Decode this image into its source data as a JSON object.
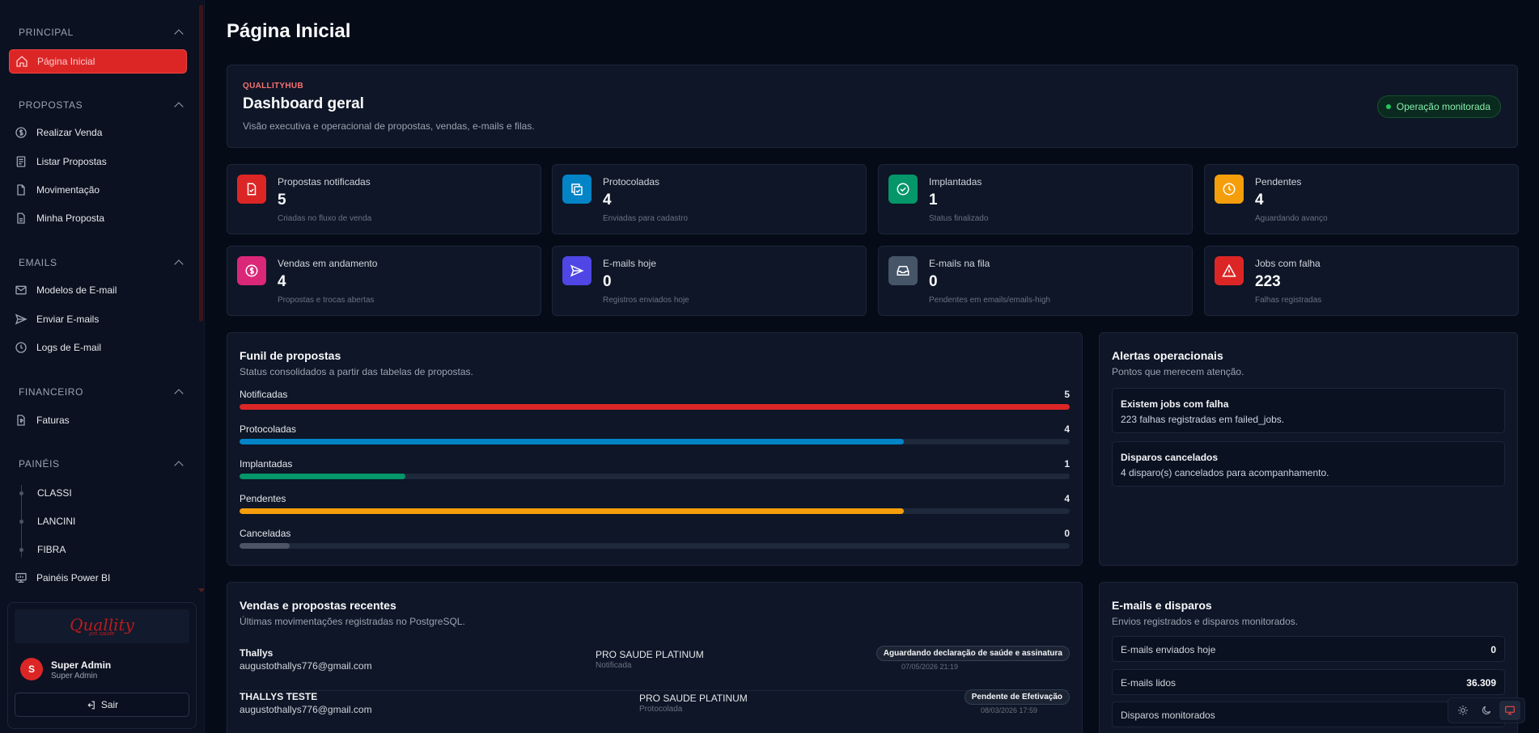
{
  "sidebar": {
    "sections": {
      "principal": "PRINCIPAL",
      "propostas": "PROPOSTAS",
      "emails": "EMAILS",
      "financeiro": "FINANCEIRO",
      "paineis": "PAINÉIS"
    },
    "items": {
      "home": "Página Inicial",
      "realizar_venda": "Realizar Venda",
      "listar_propostas": "Listar Propostas",
      "movimentacao": "Movimentação",
      "minha_proposta": "Minha Proposta",
      "modelos_email": "Modelos de E-mail",
      "enviar_emails": "Enviar E-mails",
      "logs_email": "Logs de E-mail",
      "faturas": "Faturas",
      "classi": "CLASSI",
      "lancini": "LANCINI",
      "fibra": "FIBRA",
      "paineis_powerbi": "Painéis Power BI"
    },
    "logo": {
      "word": "Quallity",
      "sub": "pró saúde"
    },
    "user": {
      "initial": "S",
      "name": "Super Admin",
      "role": "Super Admin"
    },
    "logout_label": "Sair"
  },
  "page": {
    "title": "Página Inicial"
  },
  "hero": {
    "brand": "QUALLITYHUB",
    "title": "Dashboard geral",
    "subtitle": "Visão executiva e operacional de propostas, vendas, e-mails e filas.",
    "badge": "Operação monitorada"
  },
  "stats": [
    {
      "label": "Propostas notificadas",
      "value": "5",
      "hint": "Criadas no fluxo de venda",
      "icon": "file-check-icon",
      "color": "#dc2626"
    },
    {
      "label": "Protocoladas",
      "value": "4",
      "hint": "Enviadas para cadastro",
      "icon": "copy-check-icon",
      "color": "#0284c7"
    },
    {
      "label": "Implantadas",
      "value": "1",
      "hint": "Status finalizado",
      "icon": "check-circle-icon",
      "color": "#059669"
    },
    {
      "label": "Pendentes",
      "value": "4",
      "hint": "Aguardando avanço",
      "icon": "clock-icon",
      "color": "#f59e0b"
    },
    {
      "label": "Vendas em andamento",
      "value": "4",
      "hint": "Propostas e trocas abertas",
      "icon": "dollar-circle-icon",
      "color": "#db2777"
    },
    {
      "label": "E-mails hoje",
      "value": "0",
      "hint": "Registros enviados hoje",
      "icon": "send-icon",
      "color": "#4f46e5"
    },
    {
      "label": "E-mails na fila",
      "value": "0",
      "hint": "Pendentes em emails/emails-high",
      "icon": "inbox-icon",
      "color": "#475569"
    },
    {
      "label": "Jobs com falha",
      "value": "223",
      "hint": "Falhas registradas",
      "icon": "warning-icon",
      "color": "#dc2626"
    }
  ],
  "funnel": {
    "title": "Funil de propostas",
    "subtitle": "Status consolidados a partir das tabelas de propostas.",
    "rows": [
      {
        "label": "Notificadas",
        "value": "5",
        "fraction": 1.0,
        "color": "#dc2626"
      },
      {
        "label": "Protocoladas",
        "value": "4",
        "fraction": 0.8,
        "color": "#0284c7"
      },
      {
        "label": "Implantadas",
        "value": "1",
        "fraction": 0.2,
        "color": "#059669"
      },
      {
        "label": "Pendentes",
        "value": "4",
        "fraction": 0.8,
        "color": "#f59e0b"
      },
      {
        "label": "Canceladas",
        "value": "0",
        "fraction": 0.06,
        "color": "#4b5563"
      }
    ]
  },
  "alerts": {
    "title": "Alertas operacionais",
    "subtitle": "Pontos que merecem atenção.",
    "items": [
      {
        "title": "Existem jobs com falha",
        "desc": "223 falhas registradas em failed_jobs."
      },
      {
        "title": "Disparos cancelados",
        "desc": "4 disparo(s) cancelados para acompanhamento."
      }
    ]
  },
  "sales": {
    "title": "Vendas e propostas recentes",
    "subtitle": "Últimas movimentações registradas no PostgreSQL.",
    "rows": [
      {
        "name": "Thallys",
        "email": "augustothallys776@gmail.com",
        "plan": "PRO SAUDE PLATINUM",
        "plan_status": "Notificada",
        "status": "Aguardando declaração de saúde e assinatura",
        "date": "07/05/2026 21:19"
      },
      {
        "name": "THALLYS TESTE",
        "email": "augustothallys776@gmail.com",
        "plan": "PRO SAUDE PLATINUM",
        "plan_status": "Protocolada",
        "status": "Pendente de Efetivação",
        "date": "08/03/2026 17:59"
      }
    ]
  },
  "emails": {
    "title": "E-mails e disparos",
    "subtitle": "Envios registrados e disparos monitorados.",
    "rows": [
      {
        "label": "E-mails enviados hoje",
        "value": "0"
      },
      {
        "label": "E-mails lidos",
        "value": "36.309"
      },
      {
        "label": "Disparos monitorados",
        "value": ""
      }
    ]
  },
  "theme": {
    "active": "system",
    "icons": [
      "sun-icon",
      "moon-icon",
      "monitor-icon"
    ]
  }
}
